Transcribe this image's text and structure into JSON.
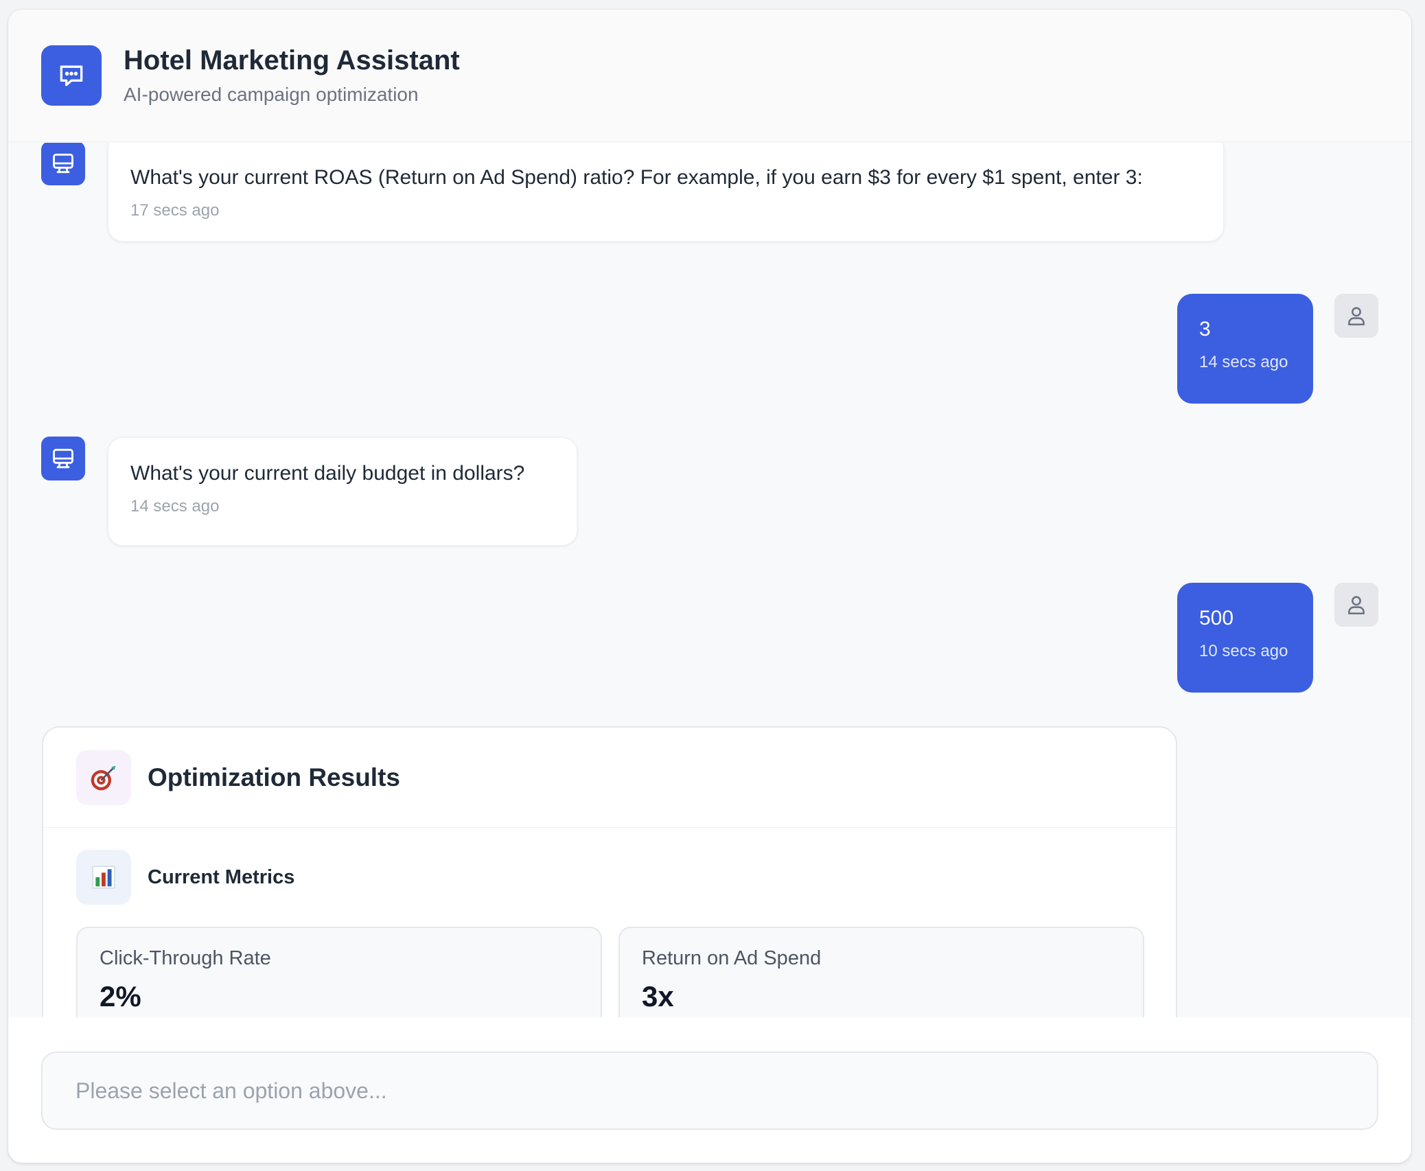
{
  "header": {
    "title": "Hotel Marketing Assistant",
    "subtitle": "AI-powered campaign optimization",
    "logo_icon": "chat-bubble-icon"
  },
  "messages": [
    {
      "sender": "bot",
      "text": "What's your current ROAS (Return on Ad Spend) ratio? For example, if you earn $3 for every $1 spent, enter 3:",
      "time": "17 secs ago"
    },
    {
      "sender": "user",
      "text": "3",
      "time": "14 secs ago"
    },
    {
      "sender": "bot",
      "text": "What's your current daily budget in dollars?",
      "time": "14 secs ago"
    },
    {
      "sender": "user",
      "text": "500",
      "time": "10 secs ago"
    }
  ],
  "results": {
    "title": "Optimization Results",
    "icon": "target-icon",
    "section_title": "Current Metrics",
    "section_icon": "bar-chart-icon",
    "metrics": [
      {
        "label": "Click-Through Rate",
        "value": "2%"
      },
      {
        "label": "Return on Ad Spend",
        "value": "3x"
      }
    ]
  },
  "input": {
    "placeholder": "Please select an option above...",
    "value": ""
  },
  "colors": {
    "accent": "#3b5fe0",
    "background": "#f8f9fa",
    "bot_bubble": "#ffffff",
    "user_avatar_bg": "#e5e7eb"
  }
}
